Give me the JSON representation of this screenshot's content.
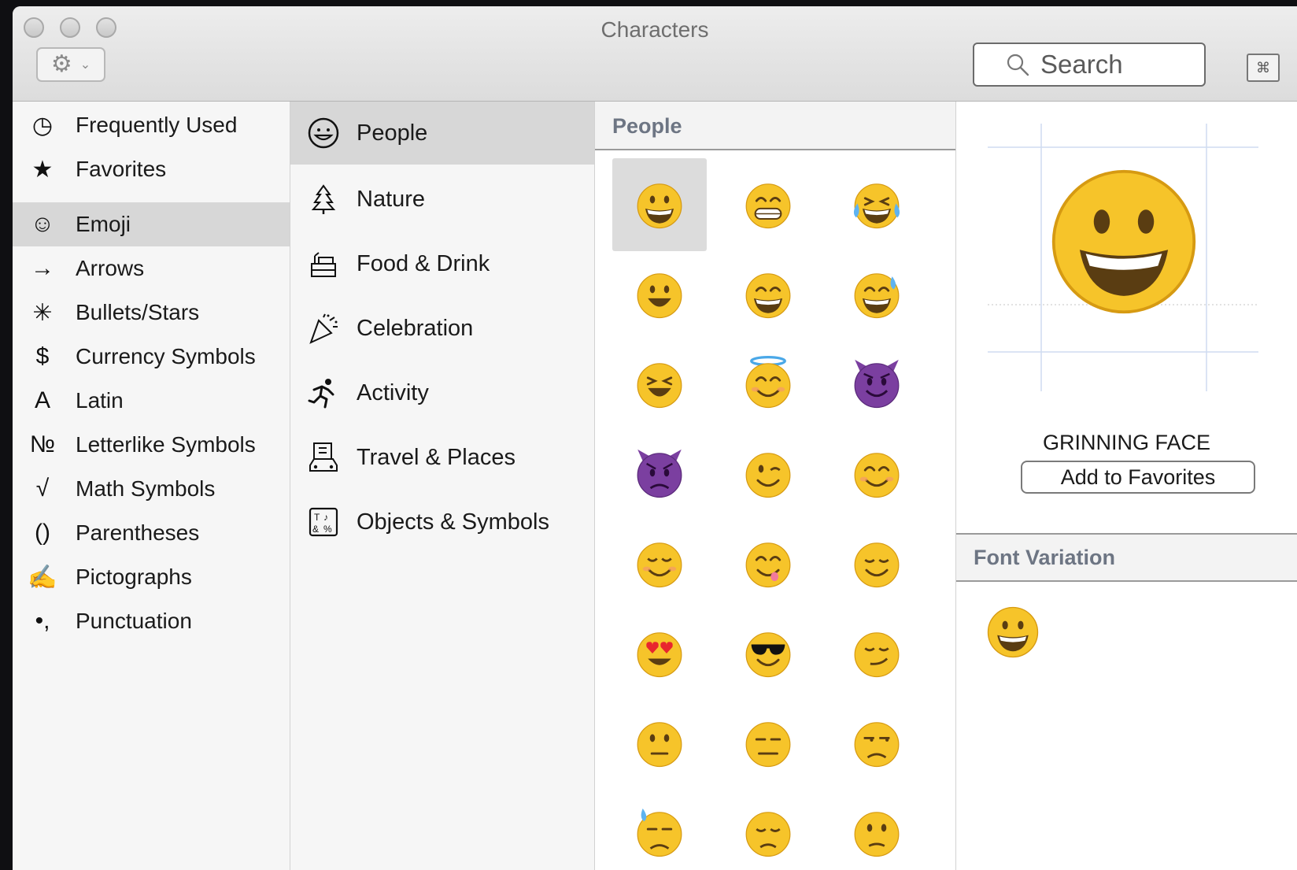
{
  "window": {
    "title": "Characters"
  },
  "toolbar": {
    "search_placeholder": "Search"
  },
  "categories": [
    {
      "label": "Frequently Used",
      "icon": "clock-icon",
      "glyph": "◷"
    },
    {
      "label": "Favorites",
      "icon": "star-icon",
      "glyph": "★"
    },
    {
      "label": "Emoji",
      "icon": "smiley-icon",
      "glyph": "☺",
      "selected": true
    },
    {
      "label": "Arrows",
      "icon": "arrow-icon",
      "glyph": "→"
    },
    {
      "label": "Bullets/Stars",
      "icon": "asterisk-icon",
      "glyph": "✳"
    },
    {
      "label": "Currency Symbols",
      "icon": "dollar-icon",
      "glyph": "$"
    },
    {
      "label": "Latin",
      "icon": "latin-a-icon",
      "glyph": "A"
    },
    {
      "label": "Letterlike Symbols",
      "icon": "numero-icon",
      "glyph": "№"
    },
    {
      "label": "Math Symbols",
      "icon": "sqrt-icon",
      "glyph": "√"
    },
    {
      "label": "Parentheses",
      "icon": "parentheses-icon",
      "glyph": "()"
    },
    {
      "label": "Pictographs",
      "icon": "pen-icon",
      "glyph": "✍"
    },
    {
      "label": "Punctuation",
      "icon": "punctuation-icon",
      "glyph": "•,"
    }
  ],
  "subcategories": [
    {
      "label": "People",
      "icon": "people-smiley-icon",
      "selected": true
    },
    {
      "label": "Nature",
      "icon": "tree-icon"
    },
    {
      "label": "Food & Drink",
      "icon": "cake-icon"
    },
    {
      "label": "Celebration",
      "icon": "party-popper-icon"
    },
    {
      "label": "Activity",
      "icon": "runner-icon"
    },
    {
      "label": "Travel & Places",
      "icon": "building-car-icon"
    },
    {
      "label": "Objects & Symbols",
      "icon": "objects-symbols-icon"
    }
  ],
  "grid": {
    "header": "People",
    "emojis": [
      {
        "name": "grinning-face",
        "kind": "grin",
        "selected": true
      },
      {
        "name": "grimacing-face",
        "kind": "grimace"
      },
      {
        "name": "face-with-tears-of-joy",
        "kind": "tears"
      },
      {
        "name": "smiling-face-open-mouth",
        "kind": "smile-open"
      },
      {
        "name": "smiling-face-smiling-eyes-open-mouth",
        "kind": "smile-eyes-open"
      },
      {
        "name": "smiling-face-cold-sweat",
        "kind": "sweat"
      },
      {
        "name": "smiling-face-tightly-closed-eyes",
        "kind": "closed-eyes"
      },
      {
        "name": "smiling-face-with-halo",
        "kind": "halo"
      },
      {
        "name": "smiling-face-with-horns",
        "kind": "devil-smile"
      },
      {
        "name": "imp",
        "kind": "devil-angry"
      },
      {
        "name": "winking-face",
        "kind": "wink"
      },
      {
        "name": "smiling-face-smiling-eyes",
        "kind": "blush-smile"
      },
      {
        "name": "relaxed",
        "kind": "relaxed"
      },
      {
        "name": "face-savouring-food",
        "kind": "yum"
      },
      {
        "name": "relieved-face",
        "kind": "relieved"
      },
      {
        "name": "heart-eyes",
        "kind": "heart-eyes"
      },
      {
        "name": "smiling-face-with-sunglasses",
        "kind": "sunglasses"
      },
      {
        "name": "smirking-face",
        "kind": "smirk"
      },
      {
        "name": "neutral-face",
        "kind": "neutral"
      },
      {
        "name": "expressionless-face",
        "kind": "expressionless"
      },
      {
        "name": "unamused-face",
        "kind": "unamused"
      },
      {
        "name": "face-with-cold-sweat",
        "kind": "cold-sweat"
      },
      {
        "name": "pensive-face",
        "kind": "pensive"
      },
      {
        "name": "confused-face",
        "kind": "confused"
      }
    ]
  },
  "detail": {
    "char_name": "GRINNING FACE",
    "add_favorites_label": "Add to Favorites",
    "font_variation_header": "Font Variation"
  },
  "colors": {
    "emoji_face": "#f6c42a",
    "devil": "#7b3fa0",
    "section_header": "#6d7583",
    "selection": "#d7d7d7"
  }
}
